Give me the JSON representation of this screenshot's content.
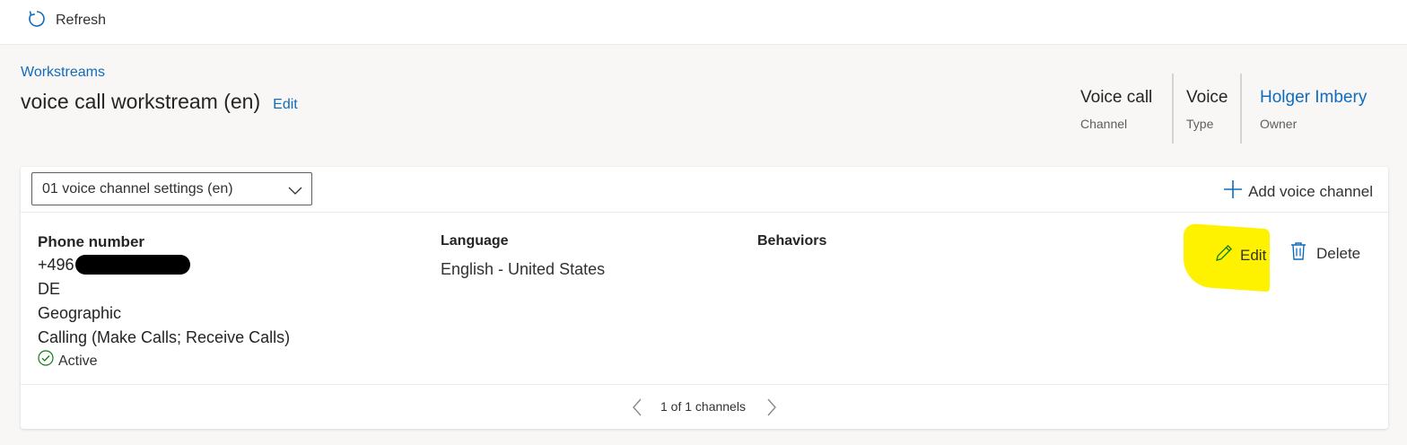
{
  "commandbar": {
    "refresh_label": "Refresh",
    "refresh_icon": "refresh-icon"
  },
  "breadcrumb": {
    "label": "Workstreams"
  },
  "header": {
    "title": "voice call workstream (en)",
    "edit_label": "Edit"
  },
  "meta": [
    {
      "value": "Voice call",
      "label": "Channel"
    },
    {
      "value": "Voice",
      "label": "Type"
    },
    {
      "value": "Holger Imbery",
      "label": "Owner"
    }
  ],
  "channel_selector": {
    "selected": "01 voice channel settings (en)"
  },
  "add_channel": {
    "label": "Add voice channel",
    "icon": "plus-icon"
  },
  "channel": {
    "phone_header": "Phone number",
    "phone_number": "+496",
    "country": "DE",
    "number_type": "Geographic",
    "calling": "Calling (Make Calls; Receive Calls)",
    "status": "Active",
    "language_header": "Language",
    "language": "English - United States",
    "behaviors_header": "Behaviors",
    "edit_label": "Edit",
    "delete_label": "Delete"
  },
  "pager": {
    "info": "1 of 1 channels"
  },
  "colors": {
    "accent": "#0f6cbd",
    "highlight": "#fff200",
    "status_ok": "#107c10"
  }
}
